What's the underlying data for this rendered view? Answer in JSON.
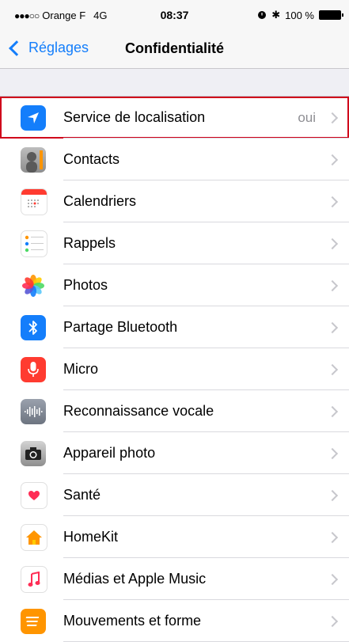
{
  "status": {
    "carrier": "Orange F",
    "network": "4G",
    "time": "08:37",
    "battery": "100 %"
  },
  "nav": {
    "back_label": "Réglages",
    "title": "Confidentialité"
  },
  "items": [
    {
      "label": "Service de localisation",
      "value": "oui",
      "icon": "location-arrow-icon"
    },
    {
      "label": "Contacts",
      "icon": "contacts-icon"
    },
    {
      "label": "Calendriers",
      "icon": "calendar-icon"
    },
    {
      "label": "Rappels",
      "icon": "reminders-icon"
    },
    {
      "label": "Photos",
      "icon": "photos-icon"
    },
    {
      "label": "Partage Bluetooth",
      "icon": "bluetooth-icon"
    },
    {
      "label": "Micro",
      "icon": "microphone-icon"
    },
    {
      "label": "Reconnaissance vocale",
      "icon": "voice-waveform-icon"
    },
    {
      "label": "Appareil photo",
      "icon": "camera-icon"
    },
    {
      "label": "Santé",
      "icon": "health-heart-icon"
    },
    {
      "label": "HomeKit",
      "icon": "home-icon"
    },
    {
      "label": "Médias et Apple Music",
      "icon": "music-note-icon"
    },
    {
      "label": "Mouvements et forme",
      "icon": "motion-icon"
    }
  ],
  "colors": {
    "accent": "#147efb",
    "highlight": "#d0021b"
  }
}
